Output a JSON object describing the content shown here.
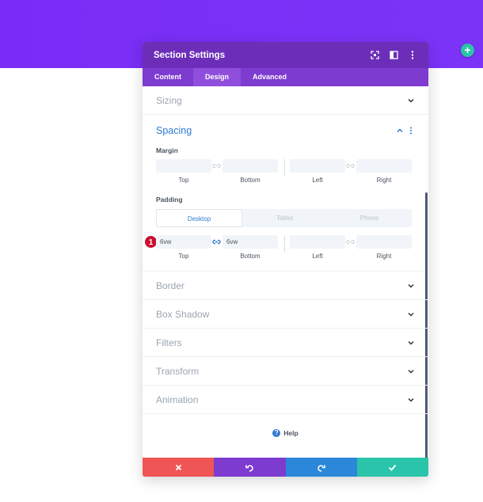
{
  "colors": {
    "hero": "#7b2ff7",
    "header": "#6c2eb9",
    "tabs": "#7e3bd0",
    "accent": "#2e7ad1",
    "cancel": "#ef5555",
    "undo": "#7e3bd0",
    "redo": "#2b87da",
    "save": "#29c4a9",
    "badge": "#c8102e"
  },
  "add_button": {
    "icon": "plus-icon",
    "glyph": "+"
  },
  "modal": {
    "title": "Section Settings",
    "header_icons": [
      "fullscreen-icon",
      "split-view-icon",
      "more-vertical-icon"
    ],
    "tabs": [
      {
        "label": "Content",
        "active": false
      },
      {
        "label": "Design",
        "active": true
      },
      {
        "label": "Advanced",
        "active": false
      }
    ]
  },
  "sections": {
    "sizing": "Sizing",
    "spacing": "Spacing",
    "border": "Border",
    "box_shadow": "Box Shadow",
    "filters": "Filters",
    "transform": "Transform",
    "animation": "Animation"
  },
  "margin": {
    "label": "Margin",
    "top": "",
    "bottom": "",
    "left": "",
    "right": "",
    "labels": {
      "top": "Top",
      "bottom": "Bottom",
      "left": "Left",
      "right": "Right"
    }
  },
  "padding": {
    "label": "Padding",
    "device_tabs": [
      "Desktop",
      "Tablet",
      "Phone"
    ],
    "active_device": "Desktop",
    "top": "6vw",
    "bottom": "6vw",
    "left": "",
    "right": "",
    "labels": {
      "top": "Top",
      "bottom": "Bottom",
      "left": "Left",
      "right": "Right"
    },
    "badge": "1"
  },
  "help": {
    "label": "Help",
    "icon": "help-icon",
    "glyph": "?"
  },
  "footer": [
    "close-icon",
    "undo-icon",
    "redo-icon",
    "check-icon"
  ]
}
